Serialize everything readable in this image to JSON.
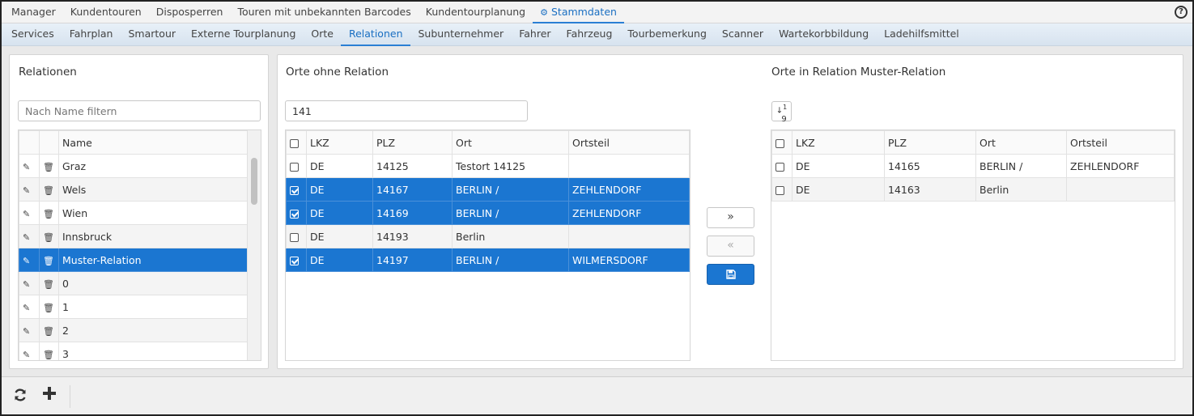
{
  "topnav": {
    "items": [
      "Manager",
      "Kundentouren",
      "Disposperren",
      "Touren mit unbekannten Barcodes",
      "Kundentourplanung"
    ],
    "active": "Stammdaten",
    "help": "?"
  },
  "subnav": {
    "items": [
      "Services",
      "Fahrplan",
      "Smartour",
      "Externe Tourplanung",
      "Orte",
      "Relationen",
      "Subunternehmer",
      "Fahrer",
      "Fahrzeug",
      "Tourbemerkung",
      "Scanner",
      "Wartekorbbildung",
      "Ladehilfsmittel"
    ],
    "active_index": 5
  },
  "relationen": {
    "title": "Relationen",
    "filter_placeholder": "Nach Name filtern",
    "column_name": "Name",
    "rows": [
      "Graz",
      "Wels",
      "Wien",
      "Innsbruck",
      "Muster-Relation",
      "0",
      "1",
      "2",
      "3"
    ],
    "selected_index": 4
  },
  "ohne": {
    "title": "Orte ohne Relation",
    "filter_value": "141",
    "columns": [
      "LKZ",
      "PLZ",
      "Ort",
      "Ortsteil"
    ],
    "rows": [
      {
        "lkz": "DE",
        "plz": "14125",
        "ort": "Testort 14125",
        "ortsteil": "",
        "checked": false
      },
      {
        "lkz": "DE",
        "plz": "14167",
        "ort": "BERLIN /",
        "ortsteil": "ZEHLENDORF",
        "checked": true
      },
      {
        "lkz": "DE",
        "plz": "14169",
        "ort": "BERLIN /",
        "ortsteil": "ZEHLENDORF",
        "checked": true
      },
      {
        "lkz": "DE",
        "plz": "14193",
        "ort": "Berlin",
        "ortsteil": "",
        "checked": false
      },
      {
        "lkz": "DE",
        "plz": "14197",
        "ort": "BERLIN /",
        "ortsteil": "WILMERSDORF",
        "checked": true
      }
    ]
  },
  "transfer": {
    "add_label": "»",
    "remove_label": "«",
    "save_icon": "save-icon"
  },
  "inrel": {
    "title": "Orte in Relation Muster-Relation",
    "sort_label": "↓1 9",
    "columns": [
      "LKZ",
      "PLZ",
      "Ort",
      "Ortsteil"
    ],
    "rows": [
      {
        "lkz": "DE",
        "plz": "14165",
        "ort": "BERLIN /",
        "ortsteil": "ZEHLENDORF"
      },
      {
        "lkz": "DE",
        "plz": "14163",
        "ort": "Berlin",
        "ortsteil": ""
      }
    ]
  },
  "colors": {
    "accent": "#1b76d1",
    "active_nav": "#1a6fc2"
  }
}
